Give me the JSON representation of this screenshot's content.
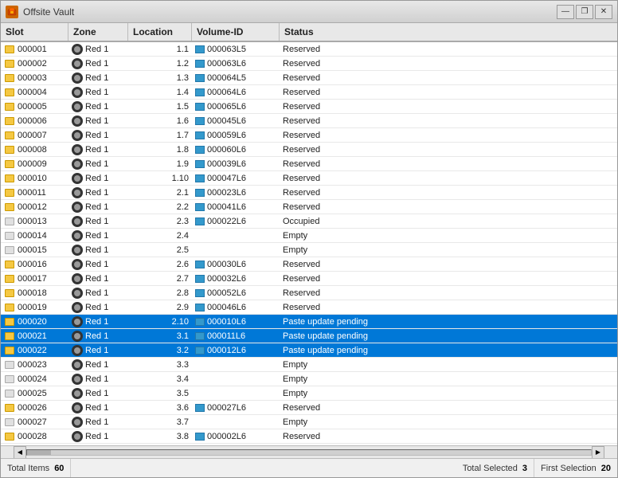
{
  "window": {
    "title": "Offsite Vault",
    "icon": "vault-icon"
  },
  "columns": [
    {
      "id": "slot",
      "label": "Slot"
    },
    {
      "id": "zone",
      "label": "Zone"
    },
    {
      "id": "location",
      "label": "Location"
    },
    {
      "id": "volume_id",
      "label": "Volume-ID"
    },
    {
      "id": "status",
      "label": "Status"
    }
  ],
  "rows": [
    {
      "slot": "000001",
      "zone": "Red 1",
      "location": "1.1",
      "volume_id": "000063L5",
      "status": "Reserved",
      "has_tape": true,
      "selected": false
    },
    {
      "slot": "000002",
      "zone": "Red 1",
      "location": "1.2",
      "volume_id": "000063L6",
      "status": "Reserved",
      "has_tape": true,
      "selected": false
    },
    {
      "slot": "000003",
      "zone": "Red 1",
      "location": "1.3",
      "volume_id": "000064L5",
      "status": "Reserved",
      "has_tape": true,
      "selected": false
    },
    {
      "slot": "000004",
      "zone": "Red 1",
      "location": "1.4",
      "volume_id": "000064L6",
      "status": "Reserved",
      "has_tape": true,
      "selected": false
    },
    {
      "slot": "000005",
      "zone": "Red 1",
      "location": "1.5",
      "volume_id": "000065L6",
      "status": "Reserved",
      "has_tape": true,
      "selected": false
    },
    {
      "slot": "000006",
      "zone": "Red 1",
      "location": "1.6",
      "volume_id": "000045L6",
      "status": "Reserved",
      "has_tape": true,
      "selected": false
    },
    {
      "slot": "000007",
      "zone": "Red 1",
      "location": "1.7",
      "volume_id": "000059L6",
      "status": "Reserved",
      "has_tape": true,
      "selected": false
    },
    {
      "slot": "000008",
      "zone": "Red 1",
      "location": "1.8",
      "volume_id": "000060L6",
      "status": "Reserved",
      "has_tape": true,
      "selected": false
    },
    {
      "slot": "000009",
      "zone": "Red 1",
      "location": "1.9",
      "volume_id": "000039L6",
      "status": "Reserved",
      "has_tape": true,
      "selected": false
    },
    {
      "slot": "000010",
      "zone": "Red 1",
      "location": "1.10",
      "volume_id": "000047L6",
      "status": "Reserved",
      "has_tape": true,
      "selected": false
    },
    {
      "slot": "000011",
      "zone": "Red 1",
      "location": "2.1",
      "volume_id": "000023L6",
      "status": "Reserved",
      "has_tape": true,
      "selected": false
    },
    {
      "slot": "000012",
      "zone": "Red 1",
      "location": "2.2",
      "volume_id": "000041L6",
      "status": "Reserved",
      "has_tape": true,
      "selected": false
    },
    {
      "slot": "000013",
      "zone": "Red 1",
      "location": "2.3",
      "volume_id": "000022L6",
      "status": "Occupied",
      "has_tape": false,
      "selected": false
    },
    {
      "slot": "000014",
      "zone": "Red 1",
      "location": "2.4",
      "volume_id": "",
      "status": "Empty",
      "has_tape": false,
      "selected": false
    },
    {
      "slot": "000015",
      "zone": "Red 1",
      "location": "2.5",
      "volume_id": "",
      "status": "Empty",
      "has_tape": false,
      "selected": false
    },
    {
      "slot": "000016",
      "zone": "Red 1",
      "location": "2.6",
      "volume_id": "000030L6",
      "status": "Reserved",
      "has_tape": true,
      "selected": false
    },
    {
      "slot": "000017",
      "zone": "Red 1",
      "location": "2.7",
      "volume_id": "000032L6",
      "status": "Reserved",
      "has_tape": true,
      "selected": false
    },
    {
      "slot": "000018",
      "zone": "Red 1",
      "location": "2.8",
      "volume_id": "000052L6",
      "status": "Reserved",
      "has_tape": true,
      "selected": false
    },
    {
      "slot": "000019",
      "zone": "Red 1",
      "location": "2.9",
      "volume_id": "000046L6",
      "status": "Reserved",
      "has_tape": true,
      "selected": false
    },
    {
      "slot": "000020",
      "zone": "Red 1",
      "location": "2.10",
      "volume_id": "000010L6",
      "status": "Paste update pending",
      "has_tape": true,
      "selected": true
    },
    {
      "slot": "000021",
      "zone": "Red 1",
      "location": "3.1",
      "volume_id": "000011L6",
      "status": "Paste update pending",
      "has_tape": true,
      "selected": true
    },
    {
      "slot": "000022",
      "zone": "Red 1",
      "location": "3.2",
      "volume_id": "000012L6",
      "status": "Paste update pending",
      "has_tape": true,
      "selected": true
    },
    {
      "slot": "000023",
      "zone": "Red 1",
      "location": "3.3",
      "volume_id": "",
      "status": "Empty",
      "has_tape": false,
      "selected": false
    },
    {
      "slot": "000024",
      "zone": "Red 1",
      "location": "3.4",
      "volume_id": "",
      "status": "Empty",
      "has_tape": false,
      "selected": false
    },
    {
      "slot": "000025",
      "zone": "Red 1",
      "location": "3.5",
      "volume_id": "",
      "status": "Empty",
      "has_tape": false,
      "selected": false
    },
    {
      "slot": "000026",
      "zone": "Red 1",
      "location": "3.6",
      "volume_id": "000027L6",
      "status": "Reserved",
      "has_tape": true,
      "selected": false
    },
    {
      "slot": "000027",
      "zone": "Red 1",
      "location": "3.7",
      "volume_id": "",
      "status": "Empty",
      "has_tape": false,
      "selected": false
    },
    {
      "slot": "000028",
      "zone": "Red 1",
      "location": "3.8",
      "volume_id": "000002L6",
      "status": "Reserved",
      "has_tape": true,
      "selected": false
    }
  ],
  "status_bar": {
    "total_items_label": "Total Items",
    "total_items_value": "60",
    "total_selected_label": "Total Selected",
    "total_selected_value": "3",
    "selection_label": "First Selection",
    "selection_value": "20"
  },
  "title_buttons": {
    "minimize": "—",
    "maximize": "❐",
    "close": "✕"
  }
}
